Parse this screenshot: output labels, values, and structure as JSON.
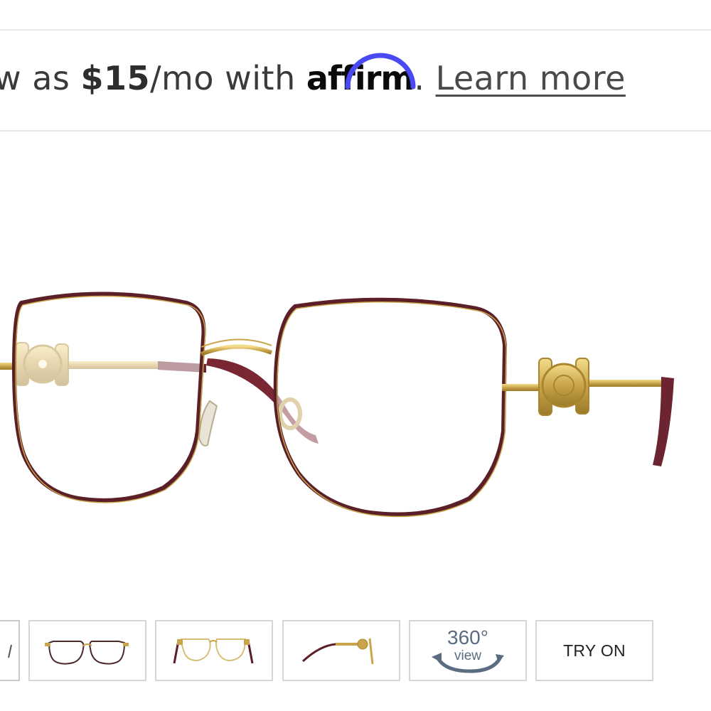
{
  "affirm": {
    "lead_text": "w as ",
    "amount": "$15",
    "term_text": "/mo with ",
    "logo_text": "affirm",
    "period": ".",
    "learn_more": "Learn more"
  },
  "product": {
    "frame_color": "#5a1f27",
    "metal_color": "#c9a44a"
  },
  "thumbnails": {
    "view_360_top": "360°",
    "view_360_bottom": "view",
    "try_on": "TRY ON"
  }
}
